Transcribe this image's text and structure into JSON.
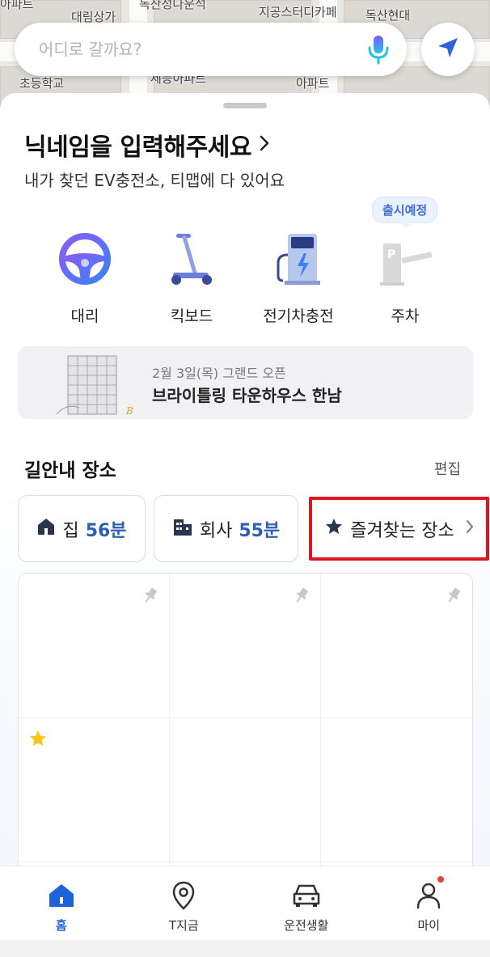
{
  "map": {
    "labels": [
      "아파트",
      "대림상가",
      "독산성나운석",
      "지공스터디카페",
      "독산현대",
      "초등학교",
      "세능아파트",
      "아파트"
    ]
  },
  "search": {
    "placeholder": "어디로 갈까요?"
  },
  "profile": {
    "nickname_prompt": "닉네임을 입력해주세요",
    "subtitle": "내가 찾던 EV충전소, 티맵에 다 있어요"
  },
  "services": [
    {
      "label": "대리",
      "icon": "steering-wheel-icon"
    },
    {
      "label": "킥보드",
      "icon": "kickboard-icon"
    },
    {
      "label": "전기차충전",
      "icon": "ev-charger-icon"
    },
    {
      "label": "주차",
      "icon": "parking-gate-icon",
      "badge": "출시예정"
    }
  ],
  "banner": {
    "date": "2월 3일(목) 그랜드 오픈",
    "title": "브라이틀링 타운하우스 한남"
  },
  "route_places": {
    "title": "길안내 장소",
    "edit_label": "편집",
    "home": {
      "label": "집",
      "time": "56분"
    },
    "work": {
      "label": "회사",
      "time": "55분"
    },
    "favorites": {
      "label": "즐겨찾는 장소"
    }
  },
  "bottom_nav": {
    "tabs": [
      {
        "label": "홈",
        "icon": "home-icon",
        "active": true
      },
      {
        "label": "T지금",
        "icon": "location-pin-icon",
        "active": false
      },
      {
        "label": "운전생활",
        "icon": "car-icon",
        "active": false
      },
      {
        "label": "마이",
        "icon": "person-icon",
        "active": false,
        "has_notification": true
      }
    ]
  },
  "colors": {
    "accent": "#1d63d8",
    "time": "#2d5eb8",
    "highlight_border": "#e0161e",
    "notification_dot": "#e8413a"
  }
}
